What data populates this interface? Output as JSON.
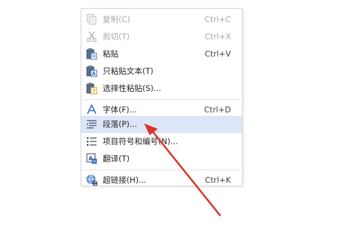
{
  "context_menu": {
    "items": [
      {
        "icon": "copy-icon",
        "label": "复制(C)",
        "shortcut": "Ctrl+C",
        "disabled": true
      },
      {
        "icon": "scissors-icon",
        "label": "剪切(T)",
        "shortcut": "Ctrl+X",
        "disabled": true
      },
      {
        "icon": "paste-icon",
        "label": "粘贴",
        "shortcut": "Ctrl+V",
        "disabled": false
      },
      {
        "icon": "paste-text-icon",
        "label": "只粘贴文本(T)",
        "shortcut": "",
        "disabled": false
      },
      {
        "icon": "paste-special-icon",
        "label": "选择性粘贴(S)...",
        "shortcut": "",
        "disabled": false
      },
      {
        "icon": "font-icon",
        "label": "字体(F)...",
        "shortcut": "Ctrl+D",
        "disabled": false
      },
      {
        "icon": "paragraph-icon",
        "label": "段落(P)...",
        "shortcut": "",
        "disabled": false,
        "highlighted": true
      },
      {
        "icon": "bullet-list-icon",
        "label": "项目符号和编号(N)...",
        "shortcut": "",
        "disabled": false
      },
      {
        "icon": "translate-icon",
        "label": "翻译(T)",
        "shortcut": "",
        "disabled": false
      },
      {
        "icon": "hyperlink-icon",
        "label": "超链接(H)...",
        "shortcut": "Ctrl+K",
        "disabled": false
      }
    ]
  },
  "annotation": {
    "arrow_color": "#d9342b"
  },
  "colors": {
    "highlight": "#dde6f7",
    "disabled_text": "#a8a8a8",
    "icon_blue": "#3a6fc4"
  }
}
